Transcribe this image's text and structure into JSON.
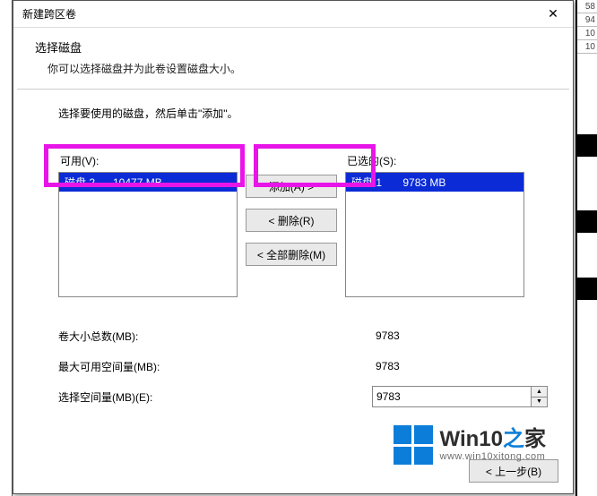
{
  "window": {
    "title": "新建跨区卷",
    "close_glyph": "✕"
  },
  "header": {
    "title": "选择磁盘",
    "subtitle": "你可以选择磁盘并为此卷设置磁盘大小。"
  },
  "body": {
    "instruction": "选择要使用的磁盘，然后单击\"添加\"。",
    "available_label": "可用(V):",
    "selected_label": "已选的(S):",
    "available_items": [
      {
        "text": "磁盘 2      10477 MB",
        "selected": true
      }
    ],
    "selected_items": [
      {
        "text": "磁盘 1       9783 MB",
        "selected": true
      }
    ],
    "add_btn": "添加(A) >",
    "remove_btn": "< 删除(R)",
    "remove_all_btn": "< 全部删除(M)"
  },
  "form": {
    "total_label": "卷大小总数(MB):",
    "total_value": "9783",
    "max_label": "最大可用空间量(MB):",
    "max_value": "9783",
    "sel_label": "选择空间量(MB)(E):",
    "sel_value": "9783"
  },
  "footer": {
    "back": "< 上一步(B)"
  },
  "watermark": {
    "brand_pre": "Win10",
    "brand_zhi": "之",
    "brand_post": "家",
    "url": "www.win10xitong.com"
  },
  "bg_numbers": [
    "58",
    "94",
    "10",
    "10"
  ]
}
